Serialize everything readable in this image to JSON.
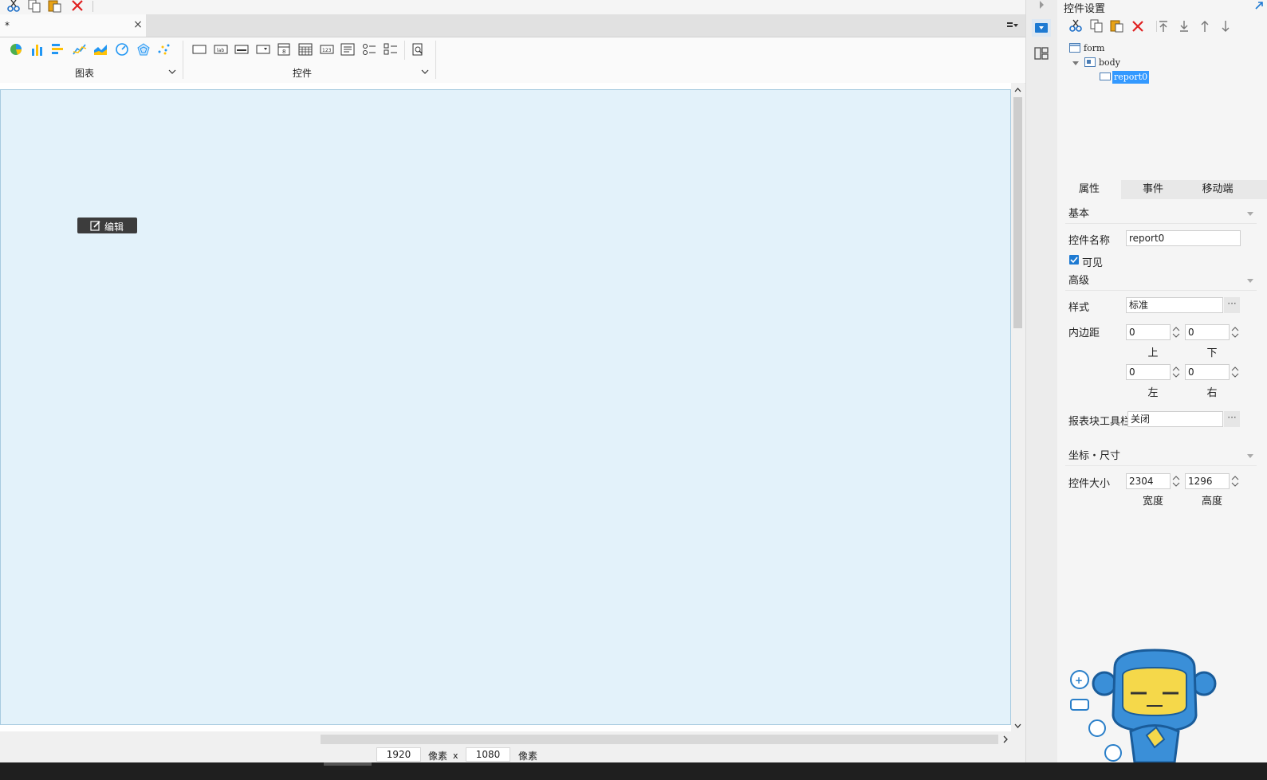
{
  "document": {
    "tab_title": "*",
    "close_glyph": "×"
  },
  "quick_toolbar": {
    "icons": [
      "cut-icon",
      "copy-icon",
      "paste-icon",
      "delete-icon"
    ]
  },
  "ribbon": {
    "chart_group": {
      "label": "图表",
      "icons": [
        "pie-chart-icon",
        "bar-chart-icon",
        "horizontal-bar-chart-icon",
        "line-chart-icon",
        "area-chart-icon",
        "gauge-chart-icon",
        "radar-chart-icon",
        "scatter-chart-icon"
      ]
    },
    "control_group": {
      "label": "控件",
      "icons": [
        "report-block-icon",
        "label-icon",
        "textbox-icon",
        "dropdown-icon",
        "date-icon",
        "calendar-icon",
        "number-icon",
        "textarea-icon",
        "radio-group-icon",
        "checkbox-group-icon",
        "preview-icon"
      ]
    }
  },
  "canvas": {
    "edit_button_label": "编辑",
    "background": "#e3f2fa"
  },
  "size_bar": {
    "width": "1920",
    "width_unit": "像素",
    "times": "x",
    "height": "1080",
    "height_unit": "像素"
  },
  "right_panel": {
    "title": "控件设置",
    "toolbar_icons": [
      "cut-icon",
      "copy-icon",
      "paste-icon",
      "delete-icon",
      "move-top-icon",
      "move-bottom-icon",
      "move-up-icon",
      "move-down-icon"
    ],
    "tree": {
      "form": "form",
      "body": "body",
      "report": "report0"
    },
    "tabs": {
      "properties": "属性",
      "events": "事件",
      "mobile": "移动端"
    },
    "basic": {
      "section": "基本",
      "name_label": "控件名称",
      "name_value": "report0",
      "visible_label": "可见",
      "visible": true
    },
    "advanced": {
      "section": "高级",
      "style_label": "样式",
      "style_value": "标准",
      "padding_label": "内边距",
      "padding": {
        "top": "0",
        "bottom": "0",
        "left": "0",
        "right": "0"
      },
      "padding_sub": {
        "top": "上",
        "bottom": "下",
        "left": "左",
        "right": "右"
      },
      "toolbar_label": "报表块工具栏",
      "toolbar_value": "关闭",
      "ellipsis": "···"
    },
    "geometry": {
      "section": "坐标・尺寸",
      "size_label": "控件大小",
      "width": "2304",
      "height": "1296",
      "width_sub": "宽度",
      "height_sub": "高度"
    }
  },
  "colors": {
    "accent": "#1e7ad2",
    "selection": "#3399ff",
    "delete_red": "#e02020"
  }
}
